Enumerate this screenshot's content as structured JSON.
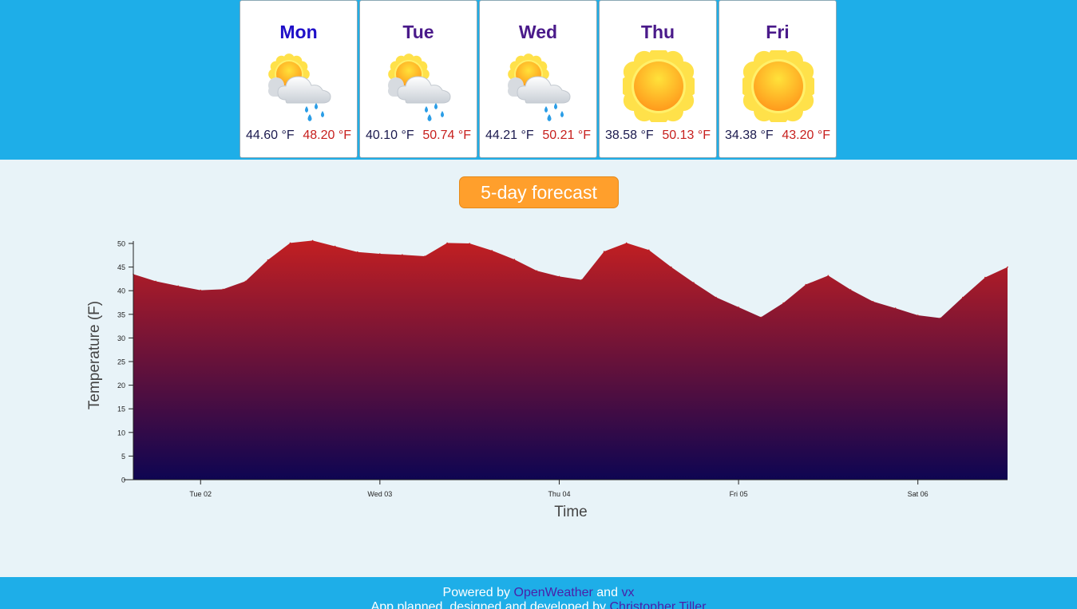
{
  "colors": {
    "band": "#1eaee8",
    "background": "#e8f3f8",
    "pill": "#ff9f2c",
    "area_top": "#c21f22",
    "area_bottom": "#0e0552",
    "min_temp": "#1b1a4e",
    "max_temp": "#c7201e"
  },
  "forecast": {
    "days": [
      {
        "day": "Mon",
        "icon": "sun-cloud-rain-icon",
        "min": "44.60 °F",
        "max": "48.20 °F",
        "day_color": "#1f0fc8"
      },
      {
        "day": "Tue",
        "icon": "sun-cloud-rain-icon",
        "min": "40.10 °F",
        "max": "50.74 °F",
        "day_color": "#4a1a8a"
      },
      {
        "day": "Wed",
        "icon": "sun-cloud-rain-icon",
        "min": "44.21 °F",
        "max": "50.21 °F",
        "day_color": "#4a1a8a"
      },
      {
        "day": "Thu",
        "icon": "sun-icon",
        "min": "38.58 °F",
        "max": "50.13 °F",
        "day_color": "#4a1a8a"
      },
      {
        "day": "Fri",
        "icon": "sun-icon",
        "min": "34.38 °F",
        "max": "43.20 °F",
        "day_color": "#4a1a8a"
      }
    ]
  },
  "chart_title": "5-day forecast",
  "chart_data": {
    "type": "area",
    "xlabel": "Time",
    "ylabel": "Temperature (F)",
    "ylim": [
      0,
      50
    ],
    "yticks": [
      0,
      5,
      10,
      15,
      20,
      25,
      30,
      35,
      40,
      45,
      50
    ],
    "xticks": [
      "Tue 02",
      "Wed 03",
      "Thu 04",
      "Fri 05",
      "Sat 06"
    ],
    "x_hours_from_tue02": [
      -9,
      -6,
      -3,
      0,
      3,
      6,
      9,
      12,
      15,
      18,
      21,
      24,
      27,
      30,
      33,
      36,
      39,
      42,
      45,
      48,
      51,
      54,
      57,
      60,
      63,
      66,
      69,
      72,
      75,
      78,
      81,
      84,
      87,
      90,
      93,
      96,
      99,
      102,
      105,
      108
    ],
    "values": [
      43.5,
      42,
      41,
      40.1,
      40.3,
      42,
      46.5,
      50.1,
      50.6,
      49.4,
      48.2,
      47.8,
      47.6,
      47.3,
      50.1,
      50,
      48.5,
      46.6,
      44.2,
      43,
      42.3,
      48.3,
      50.1,
      48.6,
      45,
      41.7,
      38.6,
      36.5,
      34.4,
      37.4,
      41.3,
      43.2,
      40.2,
      37.7,
      36.3,
      34.8,
      34.2,
      38.6,
      42.8,
      45
    ]
  },
  "footer": {
    "powered_prefix": "Powered by",
    "openweather_link": "OpenWeather",
    "and_word": "and",
    "vx_link": "vx",
    "credit_prefix": "App planned, designed and developed by",
    "author_link": "Christopher Tiller"
  }
}
